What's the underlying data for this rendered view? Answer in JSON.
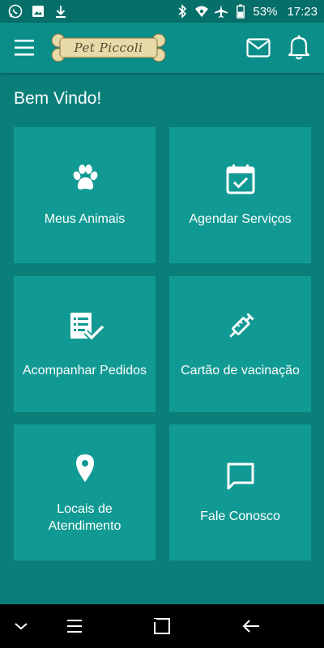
{
  "status_bar": {
    "battery": "53%",
    "time": "17:23"
  },
  "app_bar": {
    "logo_text": "Pet Piccoli"
  },
  "welcome": "Bem Vindo!",
  "cards": [
    {
      "label": "Meus Animais",
      "icon": "paw-icon"
    },
    {
      "label": "Agendar Serviços",
      "icon": "calendar-check-icon"
    },
    {
      "label": "Acompanhar Pedidos",
      "icon": "order-checklist-icon"
    },
    {
      "label": "Cartão de vacinação",
      "icon": "syringe-icon"
    },
    {
      "label": "Locais de Atendimento",
      "icon": "location-pin-icon"
    },
    {
      "label": "Fale Conosco",
      "icon": "chat-bubble-icon"
    }
  ],
  "colors": {
    "background": "#0a7f7a",
    "app_bar": "#0b8e89",
    "card": "#119a93",
    "nav_bar": "#000000"
  }
}
